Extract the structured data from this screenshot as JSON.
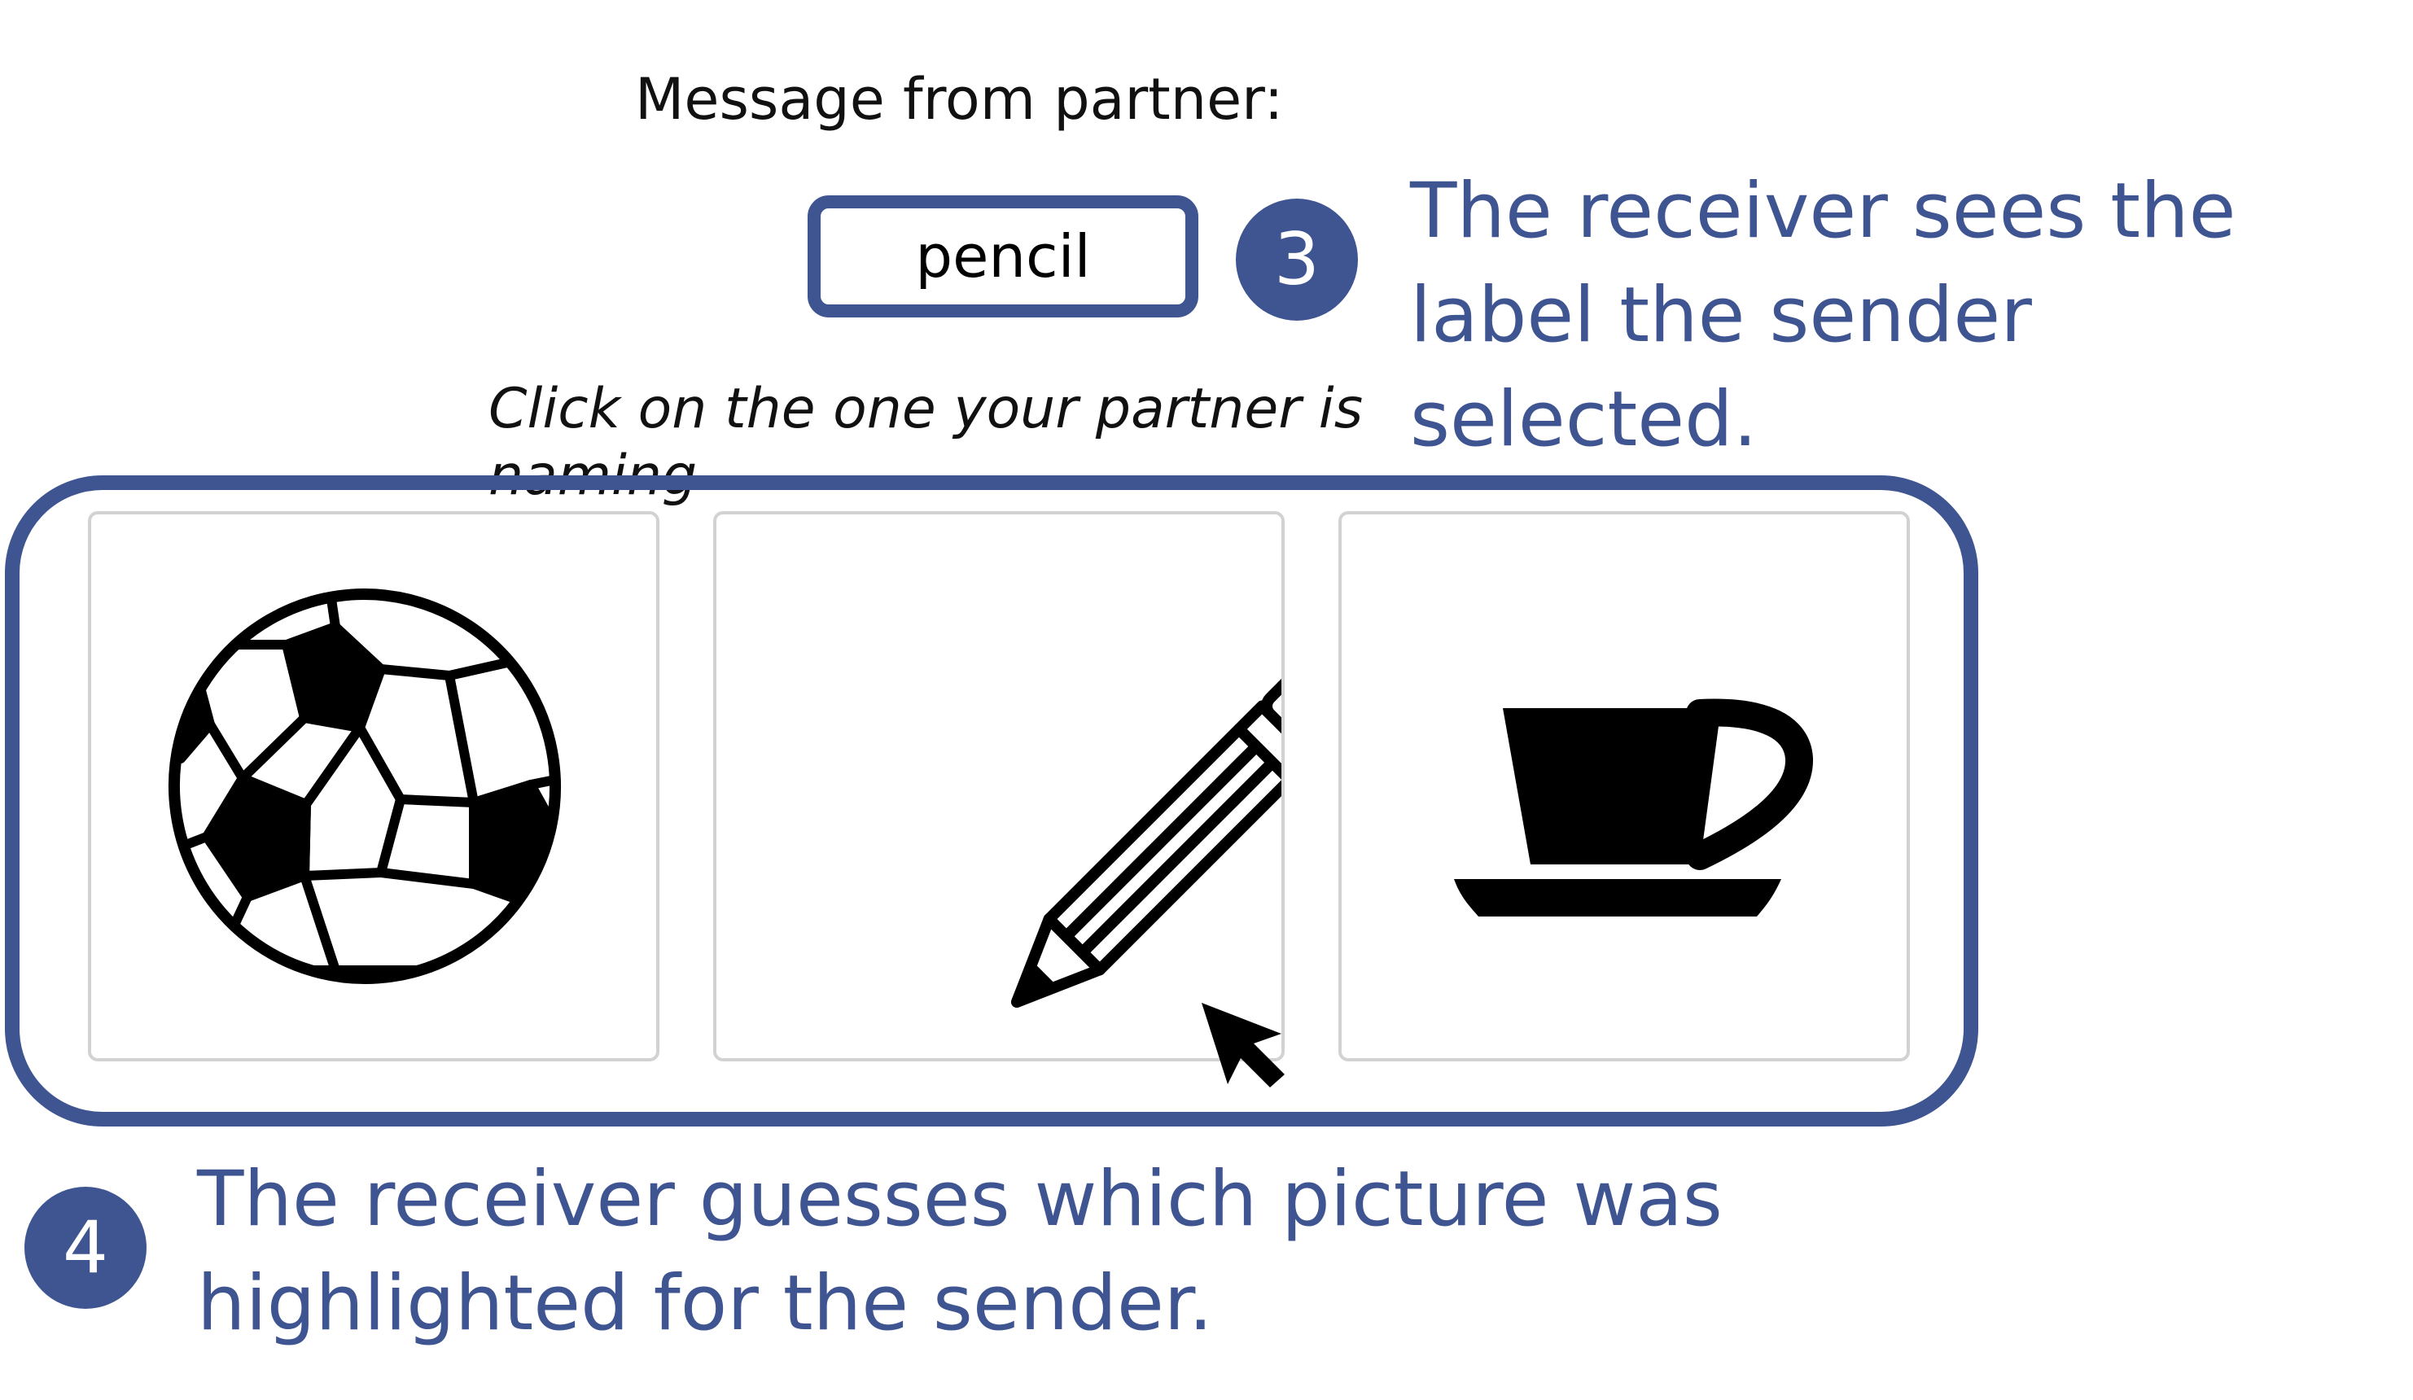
{
  "message": {
    "heading": "Message from partner:",
    "label": "pencil"
  },
  "step3": {
    "badge": "3",
    "text": "The receiver sees the label the sender selected."
  },
  "instruction": "Click on the one your partner is naming",
  "choices": [
    {
      "icon": "soccer-ball-icon"
    },
    {
      "icon": "pencil-icon"
    },
    {
      "icon": "coffee-cup-icon"
    }
  ],
  "step4": {
    "badge": "4",
    "text": "The receiver guesses which picture was highlighted for the sender."
  },
  "colors": {
    "accent": "#3f5592",
    "card_border": "#d2d2d2",
    "text": "#111111"
  }
}
